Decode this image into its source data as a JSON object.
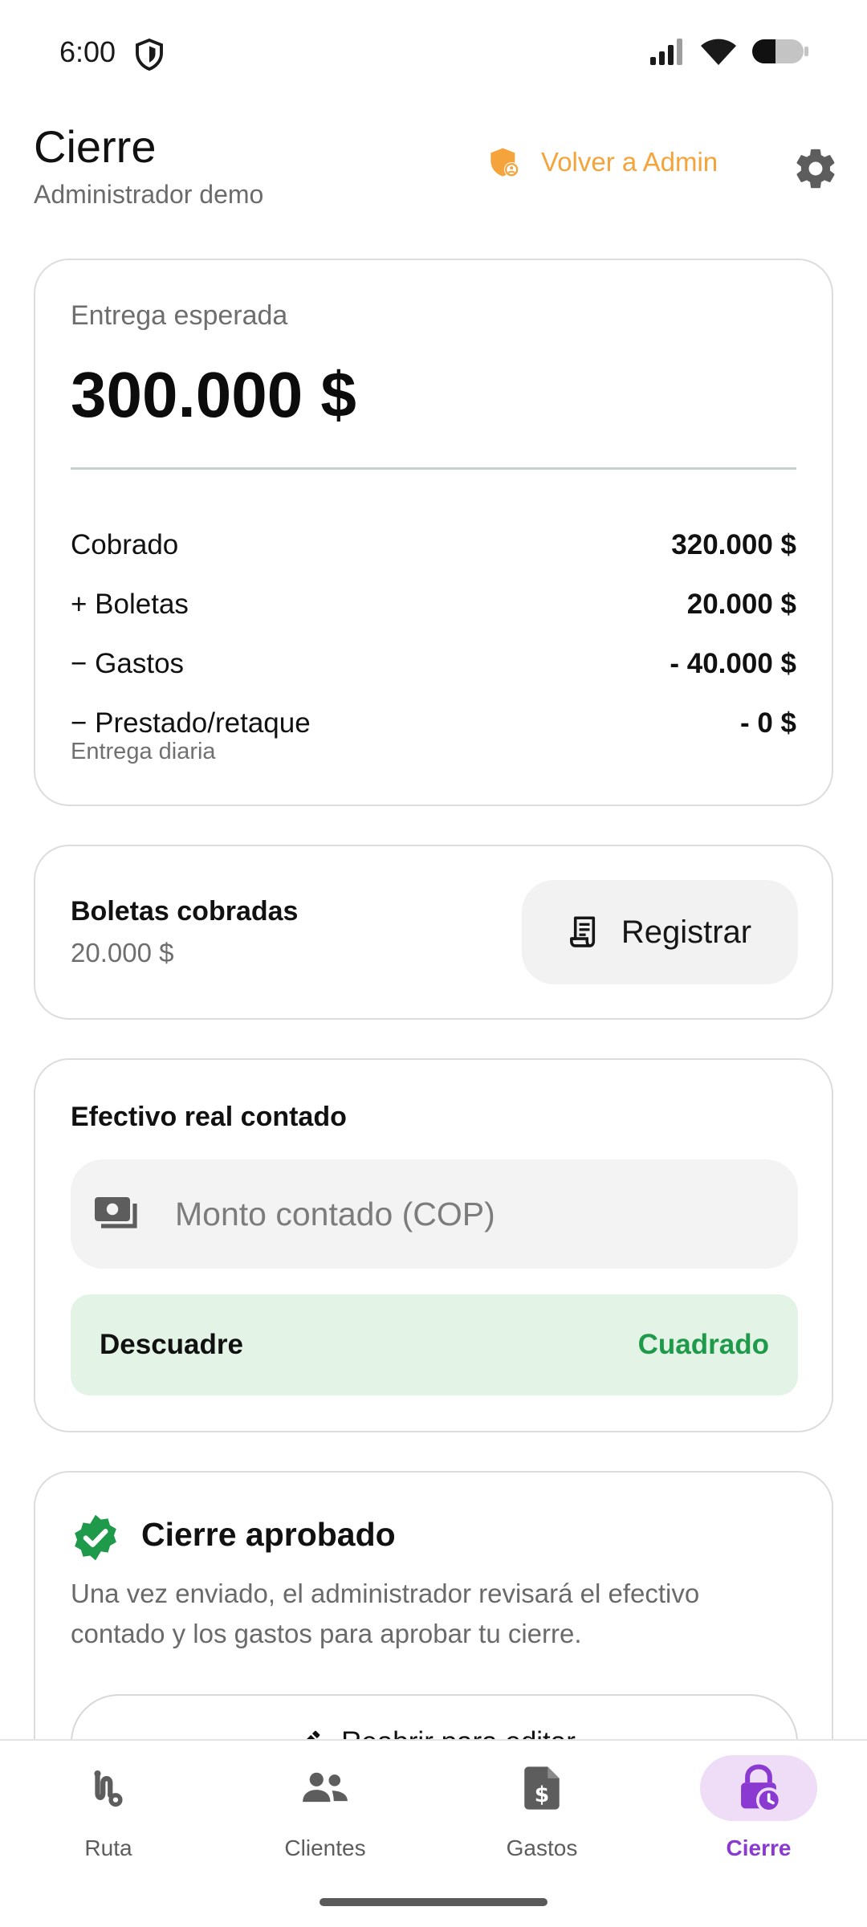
{
  "status_bar": {
    "time": "6:00",
    "icons": [
      "shield-icon",
      "signal-icon",
      "wifi-icon",
      "battery-icon"
    ]
  },
  "header": {
    "title": "Cierre",
    "subtitle": "Administrador demo",
    "admin_link_label": "Volver a Admin",
    "admin_link_icon": "admin-shield-icon",
    "settings_icon": "gear-icon"
  },
  "summary": {
    "label": "Entrega esperada",
    "amount": "300.000 $",
    "rows": [
      {
        "label": "Cobrado",
        "value": "320.000 $"
      },
      {
        "label": "+ Boletas",
        "value": "20.000 $"
      },
      {
        "label": "− Gastos",
        "value": "- 40.000 $"
      },
      {
        "label": "− Prestado/retaque",
        "value": "- 0 $"
      }
    ],
    "note": "Entrega diaria"
  },
  "boletas": {
    "title": "Boletas cobradas",
    "value": "20.000 $",
    "button_label": "Registrar",
    "button_icon": "receipt-icon"
  },
  "cash": {
    "title": "Efectivo real contado",
    "input_placeholder": "Monto contado (COP)",
    "input_value": "",
    "input_icon": "cash-icon",
    "balance_label": "Descuadre",
    "balance_status": "Cuadrado"
  },
  "approved": {
    "title": "Cierre aprobado",
    "icon": "verified-badge-icon",
    "description": "Una vez enviado, el administrador revisará el efectivo contado y los gastos para aprobar tu cierre.",
    "reopen_label": "Reabrir para editar",
    "reopen_icon": "pencil-icon"
  },
  "nav": {
    "items": [
      {
        "label": "Ruta",
        "icon": "route-icon",
        "active": false
      },
      {
        "label": "Clientes",
        "icon": "people-icon",
        "active": false
      },
      {
        "label": "Gastos",
        "icon": "expense-doc-icon",
        "active": false
      },
      {
        "label": "Cierre",
        "icon": "lock-clock-icon",
        "active": true
      }
    ]
  },
  "colors": {
    "accent_orange": "#f4a43a",
    "success_green": "#1f9a4a",
    "success_bg": "#e3f3e6",
    "nav_active": "#8a3ad0",
    "nav_active_bg": "#efdcf7"
  }
}
